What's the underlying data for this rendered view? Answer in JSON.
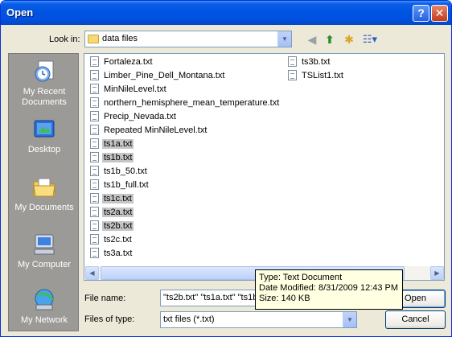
{
  "window": {
    "title": "Open"
  },
  "titlebar": {
    "help_label": "?",
    "close_label": "✕"
  },
  "lookin": {
    "label": "Look in:",
    "value": "data files"
  },
  "toolbar": {
    "back_icon": "◀",
    "up_icon": "⬆",
    "newfolder_icon": "✱",
    "view_icon": "☷▾"
  },
  "places": [
    {
      "label": "My Recent Documents",
      "icon": "recent-documents-icon"
    },
    {
      "label": "Desktop",
      "icon": "desktop-icon"
    },
    {
      "label": "My Documents",
      "icon": "my-documents-icon"
    },
    {
      "label": "My Computer",
      "icon": "my-computer-icon"
    },
    {
      "label": "My Network",
      "icon": "my-network-icon"
    }
  ],
  "files": [
    {
      "name": "Fortaleza.txt",
      "selected": false
    },
    {
      "name": "Limber_Pine_Dell_Montana.txt",
      "selected": false
    },
    {
      "name": "MinNileLevel.txt",
      "selected": false
    },
    {
      "name": "northern_hemisphere_mean_temperature.txt",
      "selected": false
    },
    {
      "name": "Precip_Nevada.txt",
      "selected": false
    },
    {
      "name": "Repeated MinNileLevel.txt",
      "selected": false
    },
    {
      "name": "ts1a.txt",
      "selected": true
    },
    {
      "name": "ts1b.txt",
      "selected": true
    },
    {
      "name": "ts1b_50.txt",
      "selected": false
    },
    {
      "name": "ts1b_full.txt",
      "selected": false
    },
    {
      "name": "ts1c.txt",
      "selected": true
    },
    {
      "name": "ts2a.txt",
      "selected": true
    },
    {
      "name": "ts2b.txt",
      "selected": true
    },
    {
      "name": "ts2c.txt",
      "selected": false
    },
    {
      "name": "ts3a.txt",
      "selected": false
    },
    {
      "name": "ts3b.txt",
      "selected": false
    },
    {
      "name": "TSList1.txt",
      "selected": false
    }
  ],
  "filename": {
    "label": "File name:",
    "value": "\"ts2b.txt\" \"ts1a.txt\" \"ts1b"
  },
  "filetype": {
    "label": "Files of type:",
    "value": "txt files (*.txt)"
  },
  "buttons": {
    "open": "Open",
    "cancel": "Cancel"
  },
  "tooltip": {
    "type": "Type: Text Document",
    "modified": "Date Modified: 8/31/2009 12:43 PM",
    "size": "Size: 140 KB"
  },
  "colors": {
    "titlebar": "#0054e3",
    "places_bg": "#9b9a96",
    "selection": "#c5c5c5",
    "dialog_bg": "#ece9d8",
    "tooltip_bg": "#ffffe1"
  }
}
